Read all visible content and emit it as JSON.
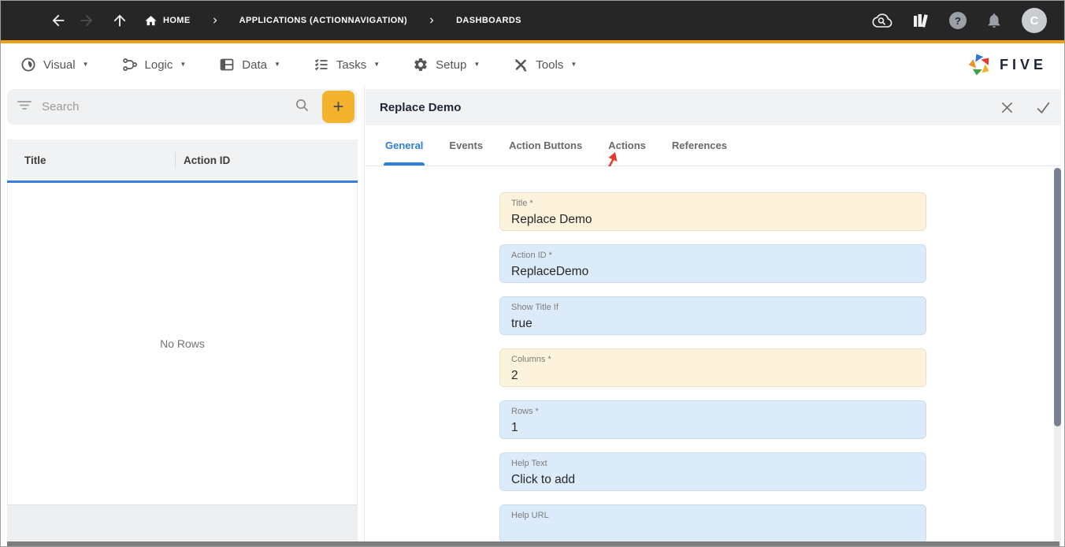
{
  "topbar": {
    "breadcrumbs": [
      "HOME",
      "APPLICATIONS (ACTIONNAVIGATION)",
      "DASHBOARDS"
    ],
    "help_glyph": "?",
    "avatar_letter": "C"
  },
  "menubar": {
    "items": [
      "Visual",
      "Logic",
      "Data",
      "Tasks",
      "Setup",
      "Tools"
    ],
    "caret_glyph": "▼",
    "logo_text": "FIVE"
  },
  "left_panel": {
    "search": {
      "placeholder": "Search"
    },
    "add_button_glyph": "+",
    "table": {
      "columns": [
        "Title",
        "Action ID"
      ],
      "rows": [],
      "empty_text": "No Rows"
    }
  },
  "right_panel": {
    "title": "Replace Demo",
    "tabs": [
      "General",
      "Events",
      "Action Buttons",
      "Actions",
      "References"
    ],
    "active_tab": "General",
    "fields": [
      {
        "label": "Title *",
        "value": "Replace Demo",
        "bg": "#fdf3dc",
        "border": "#ece0c6"
      },
      {
        "label": "Action ID *",
        "value": "ReplaceDemo",
        "bg": "#dcebfa",
        "border": "#c9ddf1"
      },
      {
        "label": "Show Title If",
        "value": "true",
        "bg": "#dcebfa",
        "border": "#c9ddf1"
      },
      {
        "label": "Columns *",
        "value": "2",
        "bg": "#fdf3dc",
        "border": "#ece0c6"
      },
      {
        "label": "Rows *",
        "value": "1",
        "bg": "#dcebfa",
        "border": "#c9ddf1"
      },
      {
        "label": "Help Text",
        "value": "Click to add",
        "bg": "#dcebfa",
        "border": "#c9ddf1"
      },
      {
        "label": "Help URL",
        "value": "",
        "bg": "#dcebfa",
        "border": "#c9ddf1"
      }
    ]
  },
  "annotations": {
    "arrow_points_to": "Actions tab",
    "arrow_color": "#e23c2c"
  },
  "colors": {
    "topbar_bg": "#262626",
    "accent_orange": "#efa211",
    "add_button_yellow": "#f4b32c",
    "accent_blue": "#2e7ed3",
    "table_blue_line": "#3b7ddc",
    "panel_header_bg": "#f1f2f4",
    "field_cream": "#fdf3dc",
    "field_blue": "#dcebfa",
    "scrollbar_thumb": "#78818f",
    "bottom_scrollbar": "#7d7d7d"
  },
  "icons": {
    "hamburger-menu": "three horizontal bars",
    "back-arrow": "left arrow",
    "forward-arrow": "right arrow (disabled)",
    "up-arrow": "up arrow",
    "home-icon": "house",
    "chevron-right": "›",
    "cloud-search-icon": "cloud with magnifier",
    "library-icon": "books",
    "help-icon": "? in circle",
    "bell-icon": "notification bell",
    "visual-icon": "lens circle",
    "logic-icon": "workflow nodes",
    "data-icon": "table grid",
    "tasks-icon": "checklist",
    "setup-icon": "gear",
    "tools-icon": "crossed tools",
    "five-logo": "pinwheel of colored triangles",
    "filter-icon": "filter lines",
    "search-icon": "magnifier",
    "plus-icon": "+",
    "close-icon": "X",
    "save-check-icon": "checkmark",
    "red-annotation-arrow": "red arrow pointing at Actions tab"
  }
}
